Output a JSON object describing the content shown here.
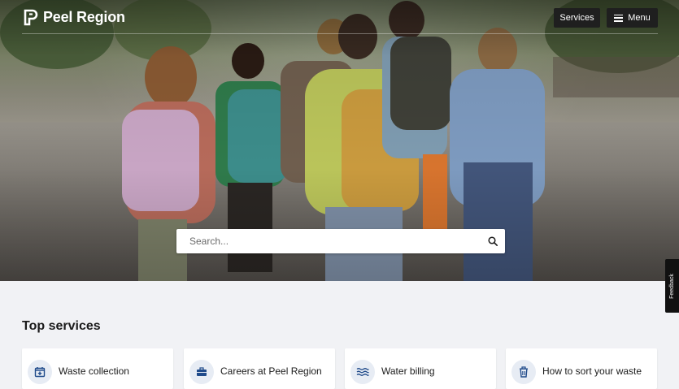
{
  "header": {
    "logo_text": "Peel Region",
    "services_label": "Services",
    "menu_label": "Menu"
  },
  "hero": {
    "search_placeholder": "Search..."
  },
  "feedback_label": "Feedback",
  "top_services": {
    "title": "Top services",
    "items": [
      {
        "label": "Waste collection",
        "icon": "calendar-plus-icon"
      },
      {
        "label": "Careers at Peel Region",
        "icon": "briefcase-icon"
      },
      {
        "label": "Water billing",
        "icon": "water-waves-icon"
      },
      {
        "label": "How to sort your waste",
        "icon": "trash-can-icon"
      }
    ]
  },
  "colors": {
    "header_button_bg": "#1f1f1f",
    "icon_circle_bg": "#e7ecf4",
    "icon_color": "#1f4a8a",
    "page_bg": "#f1f2f5"
  }
}
